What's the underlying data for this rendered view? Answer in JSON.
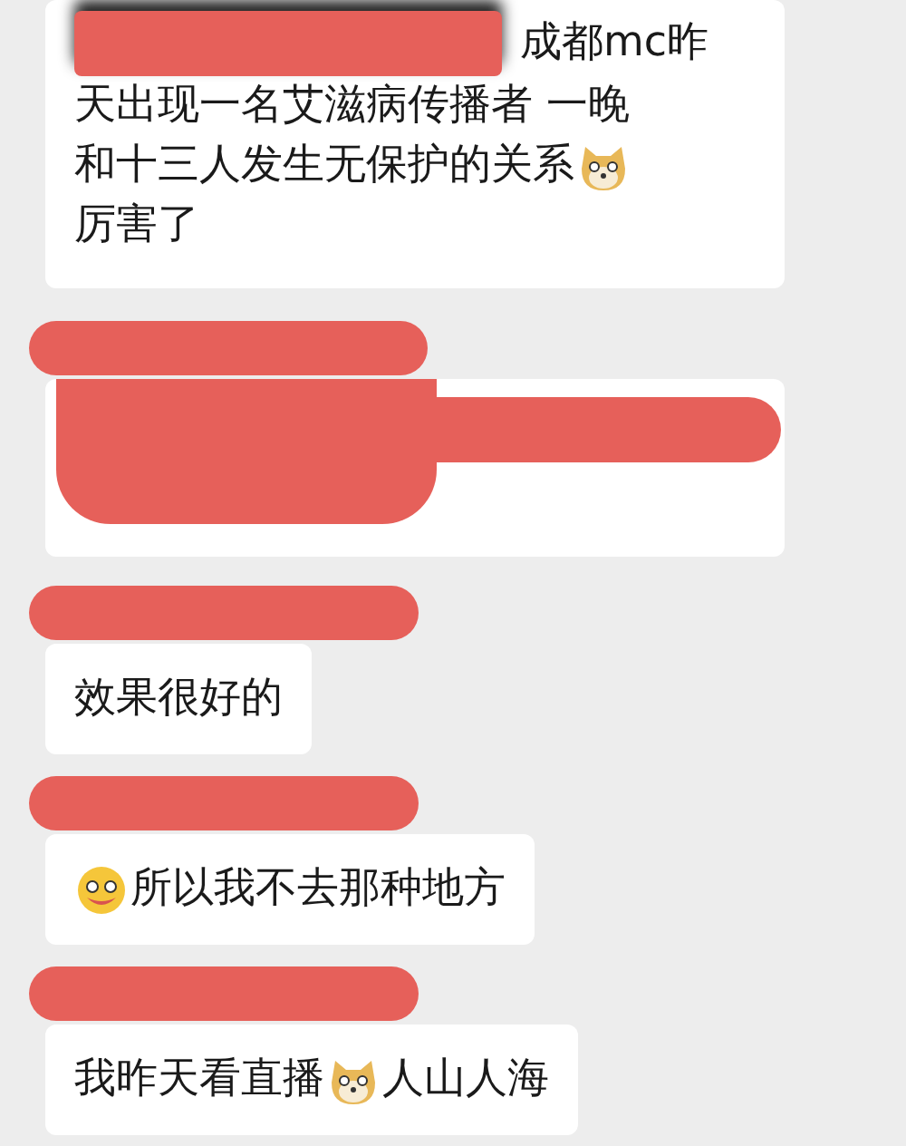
{
  "messages": [
    {
      "kind": "text",
      "name_redacted": false,
      "lines": [
        [
          {
            "kind": "redaction"
          },
          {
            "kind": "text",
            "text": "成都mc昨"
          }
        ],
        [
          {
            "kind": "text",
            "text": "天出现一名艾滋病传播者 一晚"
          }
        ],
        [
          {
            "kind": "text",
            "text": "和十三人发生无保护的关系"
          },
          {
            "kind": "doge"
          }
        ],
        [
          {
            "kind": "text",
            "text": "厉害了"
          }
        ]
      ]
    },
    {
      "kind": "redacted",
      "name_redacted": true
    },
    {
      "kind": "text",
      "name_redacted": true,
      "lines": [
        [
          {
            "kind": "text",
            "text": "效果很好的"
          }
        ]
      ]
    },
    {
      "kind": "text",
      "name_redacted": true,
      "lines": [
        [
          {
            "kind": "face"
          },
          {
            "kind": "text",
            "text": "所以我不去那种地方"
          }
        ]
      ]
    },
    {
      "kind": "text",
      "name_redacted": true,
      "lines": [
        [
          {
            "kind": "text",
            "text": "我昨天看直播"
          },
          {
            "kind": "doge"
          },
          {
            "kind": "text",
            "text": "人山人海"
          }
        ]
      ]
    }
  ]
}
